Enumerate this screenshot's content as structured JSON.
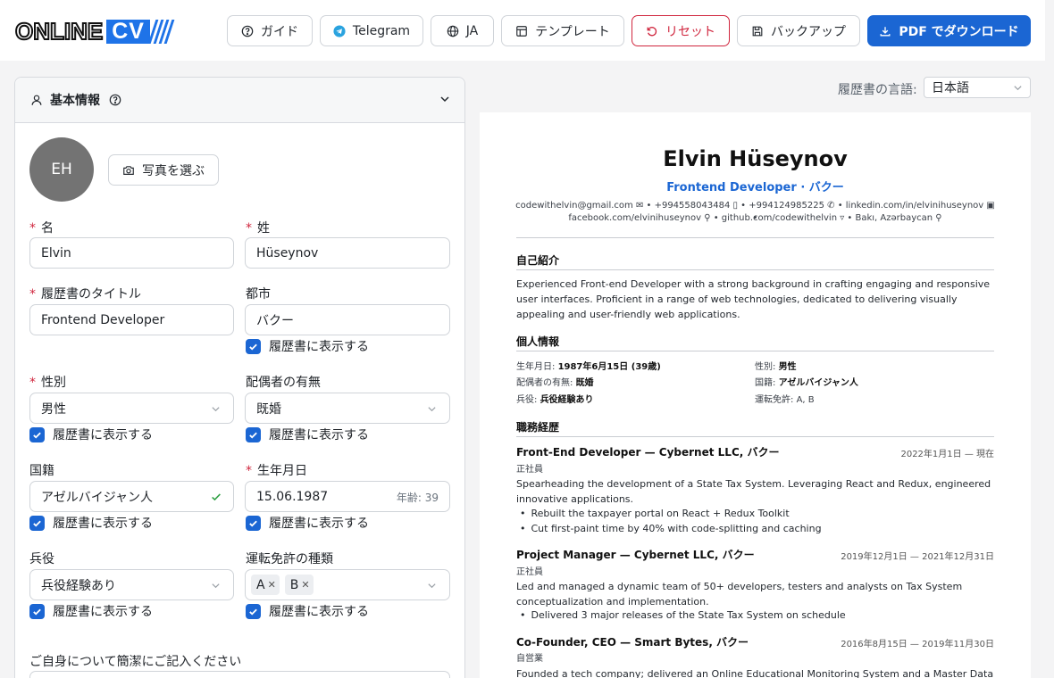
{
  "header": {
    "logo": {
      "part1": "ONLINE",
      "part2": "CV"
    },
    "buttons": {
      "guide": "ガイド",
      "telegram": "Telegram",
      "lang": "JA",
      "templates": "テンプレート",
      "reset": "リセット",
      "backup": "バックアップ",
      "download": "PDF でダウンロード"
    }
  },
  "panel": {
    "title": "基本情報",
    "photo_button": "写真を選ぶ",
    "avatar_initials": "EH",
    "required_mark": "*",
    "show_on_cv": "履歴書に表示する",
    "fields": {
      "first_name": {
        "label": "名",
        "value": "Elvin"
      },
      "last_name": {
        "label": "姓",
        "value": "Hüseynov"
      },
      "cv_title": {
        "label": "履歴書のタイトル",
        "value": "Frontend Developer"
      },
      "city": {
        "label": "都市",
        "value": "バクー"
      },
      "gender": {
        "label": "性別",
        "value": "男性"
      },
      "marital": {
        "label": "配偶者の有無",
        "value": "既婚"
      },
      "nationality": {
        "label": "国籍",
        "value": "アゼルバイジャン人"
      },
      "birthdate": {
        "label": "生年月日",
        "value": "15.06.1987",
        "age_label": "年齢: 39"
      },
      "military": {
        "label": "兵役",
        "value": "兵役経験あり"
      },
      "license": {
        "label": "運転免許の種類",
        "tags": [
          "A",
          "B"
        ]
      },
      "about": {
        "label": "ご自身について簡潔にご記入ください"
      }
    }
  },
  "cv_language": {
    "label": "履歴書の言語:",
    "value": "日本語"
  },
  "cv": {
    "name": "Elvin Hüseynov",
    "role": "Frontend Developer · バクー",
    "contact_line1": "codewithelvin@gmail.com ✉  •  +994558043484 ▯  •  +994124985225 ✆  •  linkedin.com/in/elvinihuseynov ▣  •",
    "contact_line2": "facebook.com/elvinihuseynov ⚲  •  github.com/codewithelvin ▿  •  Bakı, Azərbaycan ⚲",
    "summary_title": "自己紹介",
    "summary": "Experienced Front-end Developer with a strong background in crafting engaging and responsive user interfaces. Proficient in a range of web technologies, dedicated to delivering visually appealing and user-friendly web applications.",
    "personal_title": "個人情報",
    "personal": {
      "birth": {
        "k": "生年月日:",
        "v": "1987年6月15日 (39歳)"
      },
      "gender": {
        "k": "性別:",
        "v": "男性"
      },
      "marital": {
        "k": "配偶者の有無:",
        "v": "既婚"
      },
      "nationality": {
        "k": "国籍:",
        "v": "アゼルバイジャン人"
      },
      "military": {
        "k": "兵役:",
        "v": "兵役経験あり"
      },
      "license": {
        "k": "運転免許:",
        "v": "A, B"
      }
    },
    "experience_title": "職務経歴",
    "jobs": [
      {
        "title": "Front-End Developer — Cybernet LLC, バクー",
        "date": "2022年1月1日 — 現在",
        "type": "正社員",
        "desc": "Spearheading the development of a State Tax System. Leveraging React and Redux, engineered innovative applications.",
        "bullets": [
          "Rebuilt the taxpayer portal on React + Redux Toolkit",
          "Cut first-paint time by 40% with code-splitting and caching"
        ]
      },
      {
        "title": "Project Manager — Cybernet LLC, バクー",
        "date": "2019年12月1日 — 2021年12月31日",
        "type": "正社員",
        "desc": "Led and managed a dynamic team of 50+ developers, testers and analysts on Tax System conceptualization and implementation.",
        "bullets": [
          "Delivered 3 major releases of the State Tax System on schedule"
        ]
      },
      {
        "title": "Co-Founder, CEO — Smart Bytes, バクー",
        "date": "2016年8月15日 — 2019年11月30日",
        "type": "自営業",
        "desc": "Founded a tech company; delivered an Online Educational Monitoring System and a Master Data"
      }
    ]
  }
}
